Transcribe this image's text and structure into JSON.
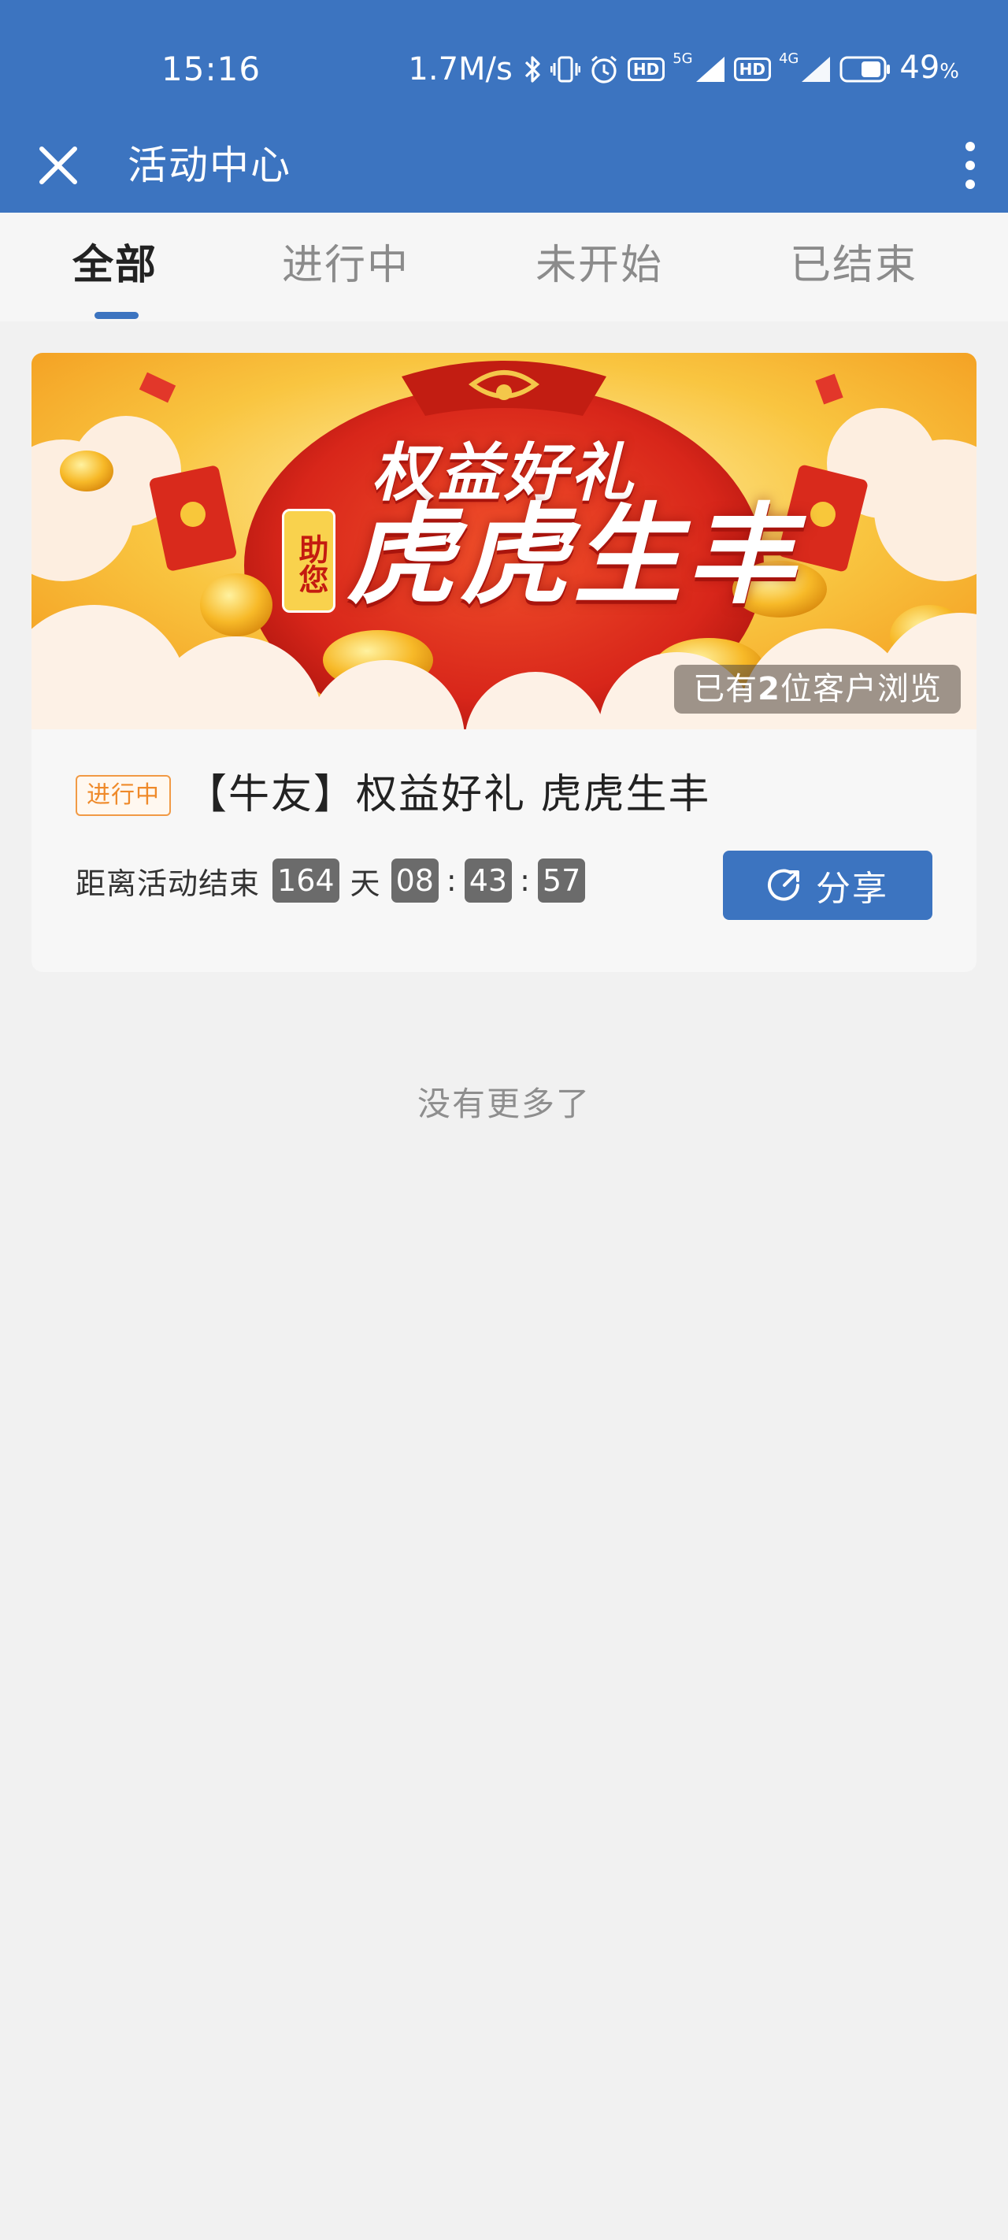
{
  "status_bar": {
    "time": "15:16",
    "net_speed": "1.7M/s",
    "hd_label": "HD",
    "network_1": "5G",
    "network_2": "4G",
    "battery": "49",
    "battery_unit": "%"
  },
  "header": {
    "title": "活动中心",
    "close_icon": "close-icon",
    "more_icon": "more-vertical-icon"
  },
  "tabs": [
    {
      "label": "全部",
      "active": true
    },
    {
      "label": "进行中",
      "active": false
    },
    {
      "label": "未开始",
      "active": false
    },
    {
      "label": "已结束",
      "active": false
    }
  ],
  "activity": {
    "banner": {
      "title_main": "权益好礼",
      "help_text": "助您",
      "title_sub": "虎虎生丰",
      "view_prefix": "已有",
      "view_count": "2",
      "view_suffix": "位客户浏览"
    },
    "status": "进行中",
    "title": "【牛友】权益好礼 虎虎生丰",
    "countdown": {
      "label": "距离活动结束",
      "days": "164",
      "days_unit": "天",
      "hours": "08",
      "minutes": "43",
      "seconds": "57",
      "separator": ":"
    },
    "share_label": "分享"
  },
  "footer": {
    "no_more": "没有更多了"
  },
  "colors": {
    "brand_blue": "#3c74c0",
    "status_orange": "#ef8a2a",
    "banner_red": "#d8261a"
  }
}
